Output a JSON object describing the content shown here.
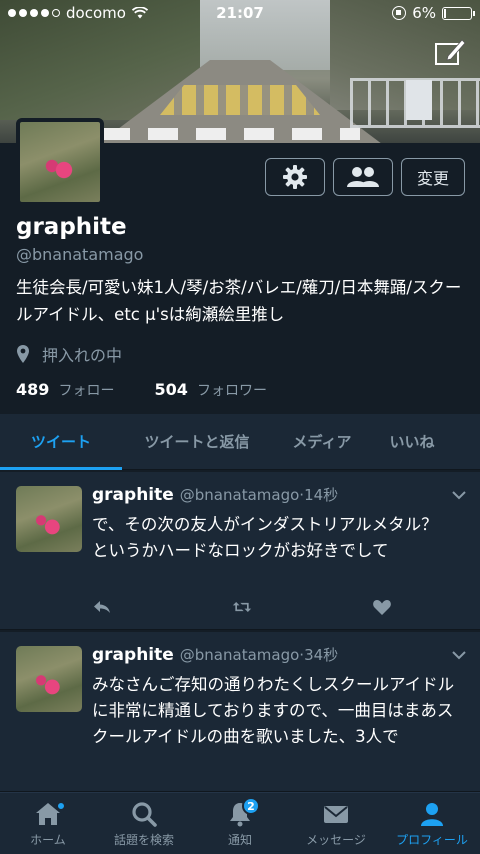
{
  "status_bar": {
    "carrier": "docomo",
    "time": "21:07",
    "battery": "6%",
    "battery_level": 0.06,
    "signal_bars": 4
  },
  "profile": {
    "name": "graphite",
    "handle": "@bnanatamago",
    "bio": "生徒会長/可愛い妹1人/琴/お茶/バレエ/薙刀/日本舞踊/スクールアイドル、etc μ'sは絢瀬絵里推し",
    "location": "押入れの中",
    "following_count": "489",
    "following_label": "フォロー",
    "followers_count": "504",
    "followers_label": "フォロワー",
    "edit_button_label": "変更"
  },
  "tabs": [
    {
      "label": "ツイート",
      "active": true
    },
    {
      "label": "ツイートと返信",
      "active": false
    },
    {
      "label": "メディア",
      "active": false
    },
    {
      "label": "いいね",
      "active": false
    }
  ],
  "tweets": [
    {
      "name": "graphite",
      "handle": "@bnanatamago",
      "time": "14秒",
      "text": "で、その次の友人がインダストリアルメタル？　というかハードなロックがお好きでして"
    },
    {
      "name": "graphite",
      "handle": "@bnanatamago",
      "time": "34秒",
      "text": "みなさんご存知の通りわたくしスクールアイドルに非常に精通しておりますので、一曲目はまあスクールアイドルの曲を歌いました、3人で"
    }
  ],
  "tab_bar": [
    {
      "label": "ホーム",
      "icon": "home-icon"
    },
    {
      "label": "話題を検索",
      "icon": "search-icon"
    },
    {
      "label": "通知",
      "icon": "bell-icon",
      "badge": "2"
    },
    {
      "label": "メッセージ",
      "icon": "mail-icon"
    },
    {
      "label": "プロフィール",
      "icon": "person-icon",
      "active": true
    }
  ],
  "colors": {
    "background": "#141d26",
    "panel": "#1b2836",
    "accent": "#1da1f2",
    "muted": "#8899a6"
  }
}
